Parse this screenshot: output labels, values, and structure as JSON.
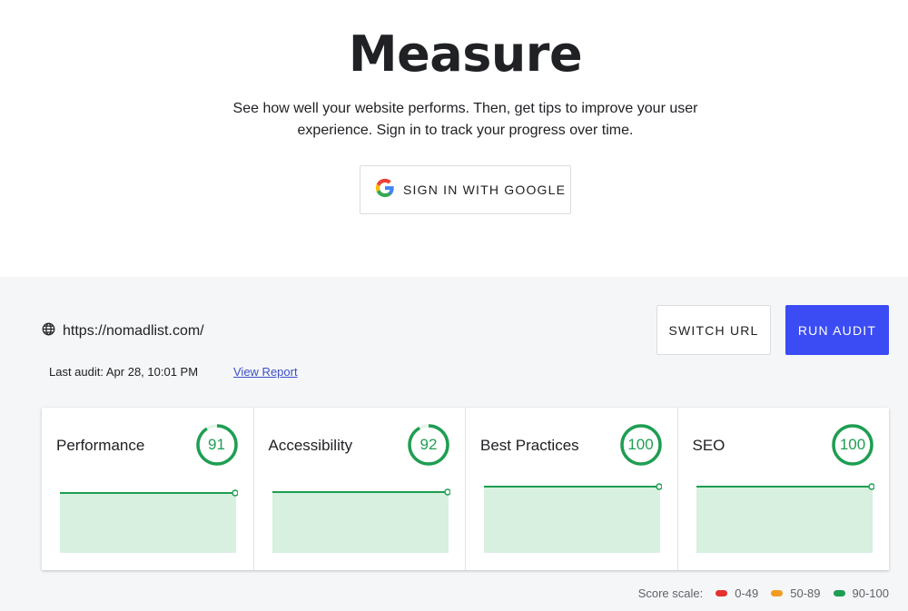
{
  "hero": {
    "title": "Measure",
    "description": "See how well your website performs. Then, get tips to improve your user experience. Sign in to track your progress over time.",
    "signin_label": "SIGN IN WITH GOOGLE"
  },
  "audit": {
    "url": "https://nomadlist.com/",
    "last_audit": "Last audit: Apr 28, 10:01 PM",
    "view_report": "View Report",
    "switch_url_label": "SWITCH URL",
    "run_audit_label": "RUN AUDIT"
  },
  "cards": [
    {
      "title": "Performance",
      "score": "91"
    },
    {
      "title": "Accessibility",
      "score": "92"
    },
    {
      "title": "Best Practices",
      "score": "100"
    },
    {
      "title": "SEO",
      "score": "100"
    }
  ],
  "score_scale": {
    "label": "Score scale:",
    "ranges": [
      {
        "label": "0-49",
        "color": "#e5322d"
      },
      {
        "label": "50-89",
        "color": "#f29c1f"
      },
      {
        "label": "90-100",
        "color": "#1e9e52"
      }
    ]
  },
  "colors": {
    "accent": "#3b4cf4",
    "good": "#1e9e52",
    "good_fill": "#d7f0e0"
  },
  "icons": {
    "signin": "google-g-icon",
    "url": "globe-icon"
  }
}
